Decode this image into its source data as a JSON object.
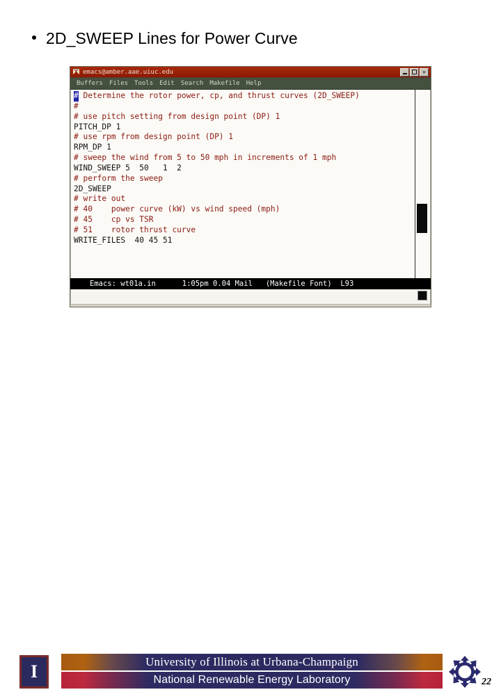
{
  "slide": {
    "bullet_title": "2D_SWEEP Lines for Power Curve",
    "page_number": "22"
  },
  "emacs_window": {
    "title": "emacs@amber.aae.uiuc.edu",
    "titlebar_icon": "x-window-icon",
    "window_buttons": [
      {
        "name": "minimize-button",
        "label": "_"
      },
      {
        "name": "maximize-button",
        "label": "□"
      },
      {
        "name": "close-button",
        "label": "✕"
      }
    ],
    "menu": [
      "Buffers",
      "Files",
      "Tools",
      "Edit",
      "Search",
      "Makefile",
      "Help"
    ],
    "code_lines": [
      {
        "text": "# Determine the rotor power, cp, and thrust curves (2D_SWEEP)",
        "kind": "comment",
        "cursor": true
      },
      {
        "text": "#",
        "kind": "comment",
        "cursor": false
      },
      {
        "text": "# use pitch setting from design point (DP) 1",
        "kind": "comment",
        "cursor": false
      },
      {
        "text": "PITCH_DP 1",
        "kind": "command",
        "cursor": false
      },
      {
        "text": "# use rpm from design point (DP) 1",
        "kind": "comment",
        "cursor": false
      },
      {
        "text": "RPM_DP 1",
        "kind": "command",
        "cursor": false
      },
      {
        "text": "# sweep the wind from 5 to 50 mph in increments of 1 mph",
        "kind": "comment",
        "cursor": false
      },
      {
        "text": "WIND_SWEEP 5  50   1  2",
        "kind": "command",
        "cursor": false
      },
      {
        "text": "# perform the sweep",
        "kind": "comment",
        "cursor": false
      },
      {
        "text": "2D_SWEEP",
        "kind": "command",
        "cursor": false
      },
      {
        "text": "# write out",
        "kind": "comment",
        "cursor": false
      },
      {
        "text": "# 40    power curve (kW) vs wind speed (mph)",
        "kind": "comment",
        "cursor": false
      },
      {
        "text": "# 45    cp vs TSR",
        "kind": "comment",
        "cursor": false
      },
      {
        "text": "# 51    rotor thrust curve",
        "kind": "comment",
        "cursor": false
      },
      {
        "text": "WRITE_FILES  40 45 51",
        "kind": "command",
        "cursor": false
      }
    ],
    "modeline": "Emacs: wt01a.in      1:05pm 0.04 Mail   (Makefile Font)  L93",
    "modeline_parts": {
      "buffer": "Emacs: wt01a.in",
      "time": "1:05pm",
      "load": "0.04",
      "mail": "Mail",
      "modes": "(Makefile Font)",
      "line": "L93"
    }
  },
  "footer": {
    "illini_logo_letter": "I",
    "banner_line_1": "University of Illinois at Urbana-Champaign",
    "banner_line_2": "National Renewable Energy Laboratory",
    "nrel_logo_name": "nrel-compass-logo"
  },
  "colors": {
    "titlebar": "#9e1f06",
    "menubar": "#45513f",
    "comment_text": "#8c1a12",
    "command_text": "#16100e",
    "modeline_bg": "#000000",
    "illini_navy": "#2b2a5e",
    "illini_orange": "#a85a10",
    "nrel_crimson": "#b6243a",
    "cursor": "#2222aa"
  }
}
